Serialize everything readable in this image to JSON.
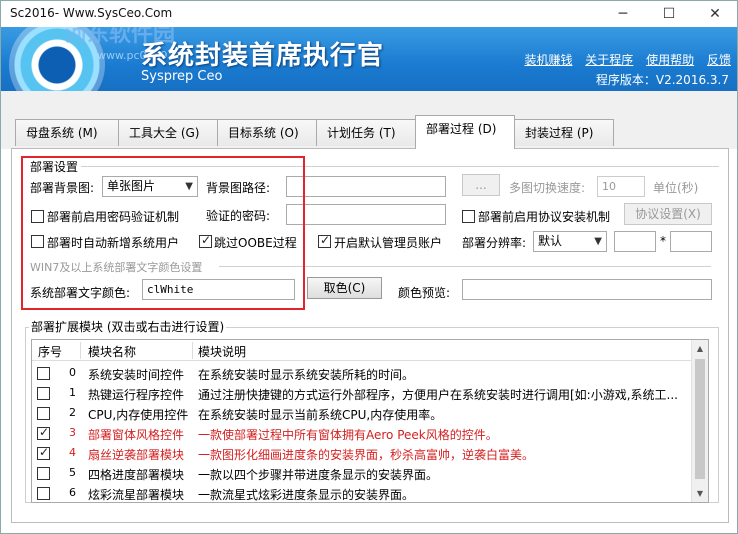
{
  "window": {
    "title": "Sc2016- Www.SysCeo.Com",
    "minimize": "─",
    "maximize": "☐",
    "close": "✕"
  },
  "banner": {
    "app_title": "系统封装首席执行官",
    "subtitle": "Sysprep Ceo",
    "watermark": "河东软件园",
    "watermark_url": "www.pc0359.cn",
    "links": [
      "装机赚钱",
      "关于程序",
      "使用帮助",
      "反馈"
    ],
    "version": "程序版本：V2.2016.3.7"
  },
  "tabs": [
    "母盘系统 (M)",
    "工具大全 (G)",
    "目标系统 (O)",
    "计划任务 (T)",
    "部署过程 (D)",
    "封装过程 (P)"
  ],
  "deploy": {
    "section_title": "部署设置",
    "bg_label": "部署背景图:",
    "bg_select": "单张图片",
    "bg_path_label": "背景图路径:",
    "bg_path_value": "",
    "browse_button": "...",
    "switch_speed_label": "多图切换速度:",
    "switch_speed_value": "10",
    "unit_label": "单位(秒)",
    "pwd_check_label": "部署前启用密码验证机制",
    "pwd_field_label": "验证的密码:",
    "pwd_value": "",
    "agreement_check_label": "部署前启用协议安装机制",
    "agreement_button": "协议设置(X)",
    "auto_user_label": "部署时自动新增系统用户",
    "skip_oobe_label": "跳过OOBE过程",
    "admin_label": "开启默认管理员账户",
    "resolution_label": "部署分辨率:",
    "resolution_value": "默认",
    "res_w": "",
    "res_x": "*",
    "res_h": "",
    "color_section": "WIN7及以上系统部署文字颜色设置",
    "text_color_label": "系统部署文字颜色:",
    "text_color_value": "clWhite",
    "pick_color_button": "取色(C)",
    "preview_label": "颜色预览:",
    "preview_value": ""
  },
  "modules": {
    "title": "部署扩展模块 (双击或右击进行设置)",
    "headers": [
      "序号",
      "模块名称",
      "模块说明"
    ],
    "rows": [
      {
        "checked": false,
        "red": false,
        "num": "0",
        "name": "系统安装时间控件",
        "desc": "在系统安装时显示系统安装所耗的时间。"
      },
      {
        "checked": false,
        "red": false,
        "num": "1",
        "name": "热键运行程序控件",
        "desc": "通过注册快捷键的方式运行外部程序，方便用户在系统安装时进行调用[如:小游戏,系统工..."
      },
      {
        "checked": false,
        "red": false,
        "num": "2",
        "name": "CPU,内存使用控件",
        "desc": "在系统安装时显示当前系统CPU,内存使用率。"
      },
      {
        "checked": true,
        "red": true,
        "num": "3",
        "name": "部署窗体风格控件",
        "desc": "一款使部署过程中所有窗体拥有Aero Peek风格的控件。"
      },
      {
        "checked": true,
        "red": true,
        "num": "4",
        "name": "扇丝逆袭部署模块",
        "desc": "一款图形化细画进度条的安装界面，秒杀高富帅，逆袭白富美。"
      },
      {
        "checked": false,
        "red": false,
        "num": "5",
        "name": "四格进度部署模块",
        "desc": "一款以四个步骤并带进度条显示的安装界面。"
      },
      {
        "checked": false,
        "red": false,
        "num": "6",
        "name": "炫彩流星部署模块",
        "desc": "一款流星式炫彩进度条显示的安装界面。"
      }
    ]
  }
}
